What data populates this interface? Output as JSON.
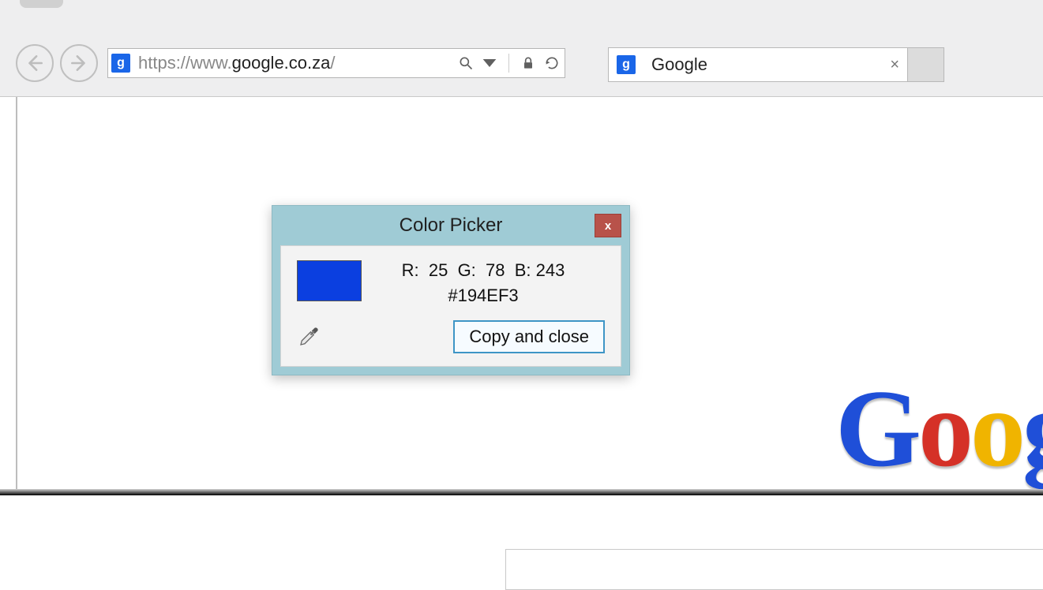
{
  "browser": {
    "url_protocol": "https://",
    "url_prefix": "www.",
    "url_host": "google.co.za",
    "url_suffix": "/",
    "tab_title": "Google",
    "favicon_letter": "g"
  },
  "picker": {
    "title": "Color Picker",
    "close_glyph": "x",
    "r_label": "R:",
    "g_label": "G:",
    "b_label": "B:",
    "r_value": "25",
    "g_value": "78",
    "b_value": "243",
    "hex": "#194EF3",
    "swatch_color": "#0b3fe0",
    "copy_label": "Copy and close"
  },
  "logo": {
    "c1": "G",
    "c2": "o",
    "c3": "o",
    "c4": "g"
  }
}
